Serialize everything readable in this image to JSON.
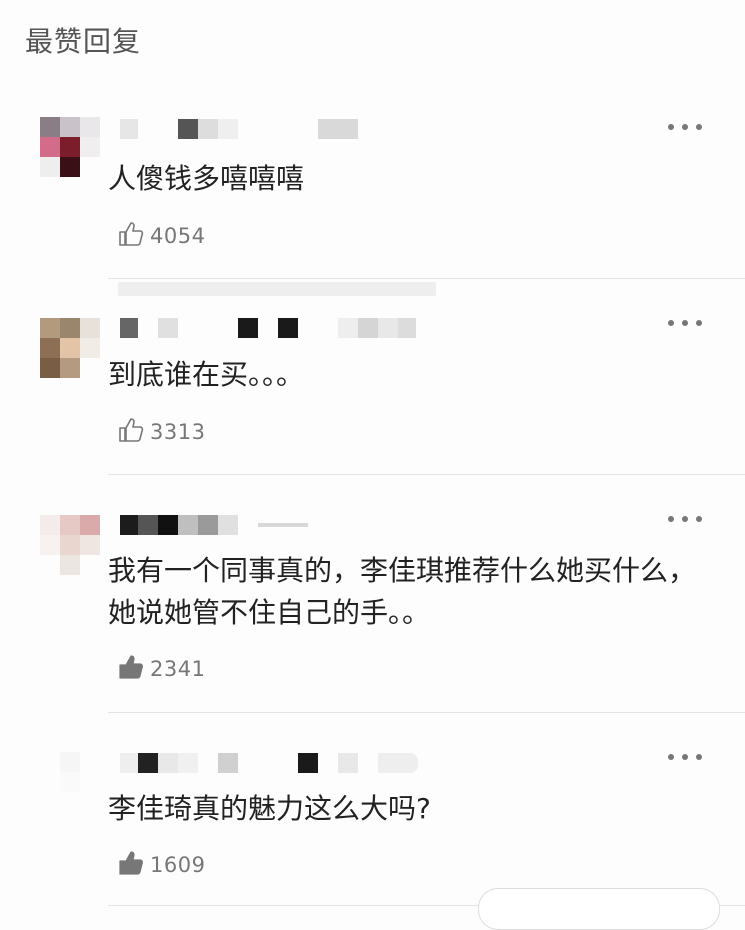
{
  "header": {
    "title": "最赞回复"
  },
  "comments": [
    {
      "text": "人傻钱多嘻嘻嘻",
      "likes": "4054",
      "like_style": "outline"
    },
    {
      "text": "到底谁在买。。。",
      "likes": "3313",
      "like_style": "outline"
    },
    {
      "text": "我有一个同事真的，李佳琪推荐什么她买什么，她说她管不住自己的手。。",
      "likes": "2341",
      "like_style": "filled"
    },
    {
      "text": "李佳琦真的魅力这么大吗?",
      "likes": "1609",
      "like_style": "filled"
    }
  ]
}
